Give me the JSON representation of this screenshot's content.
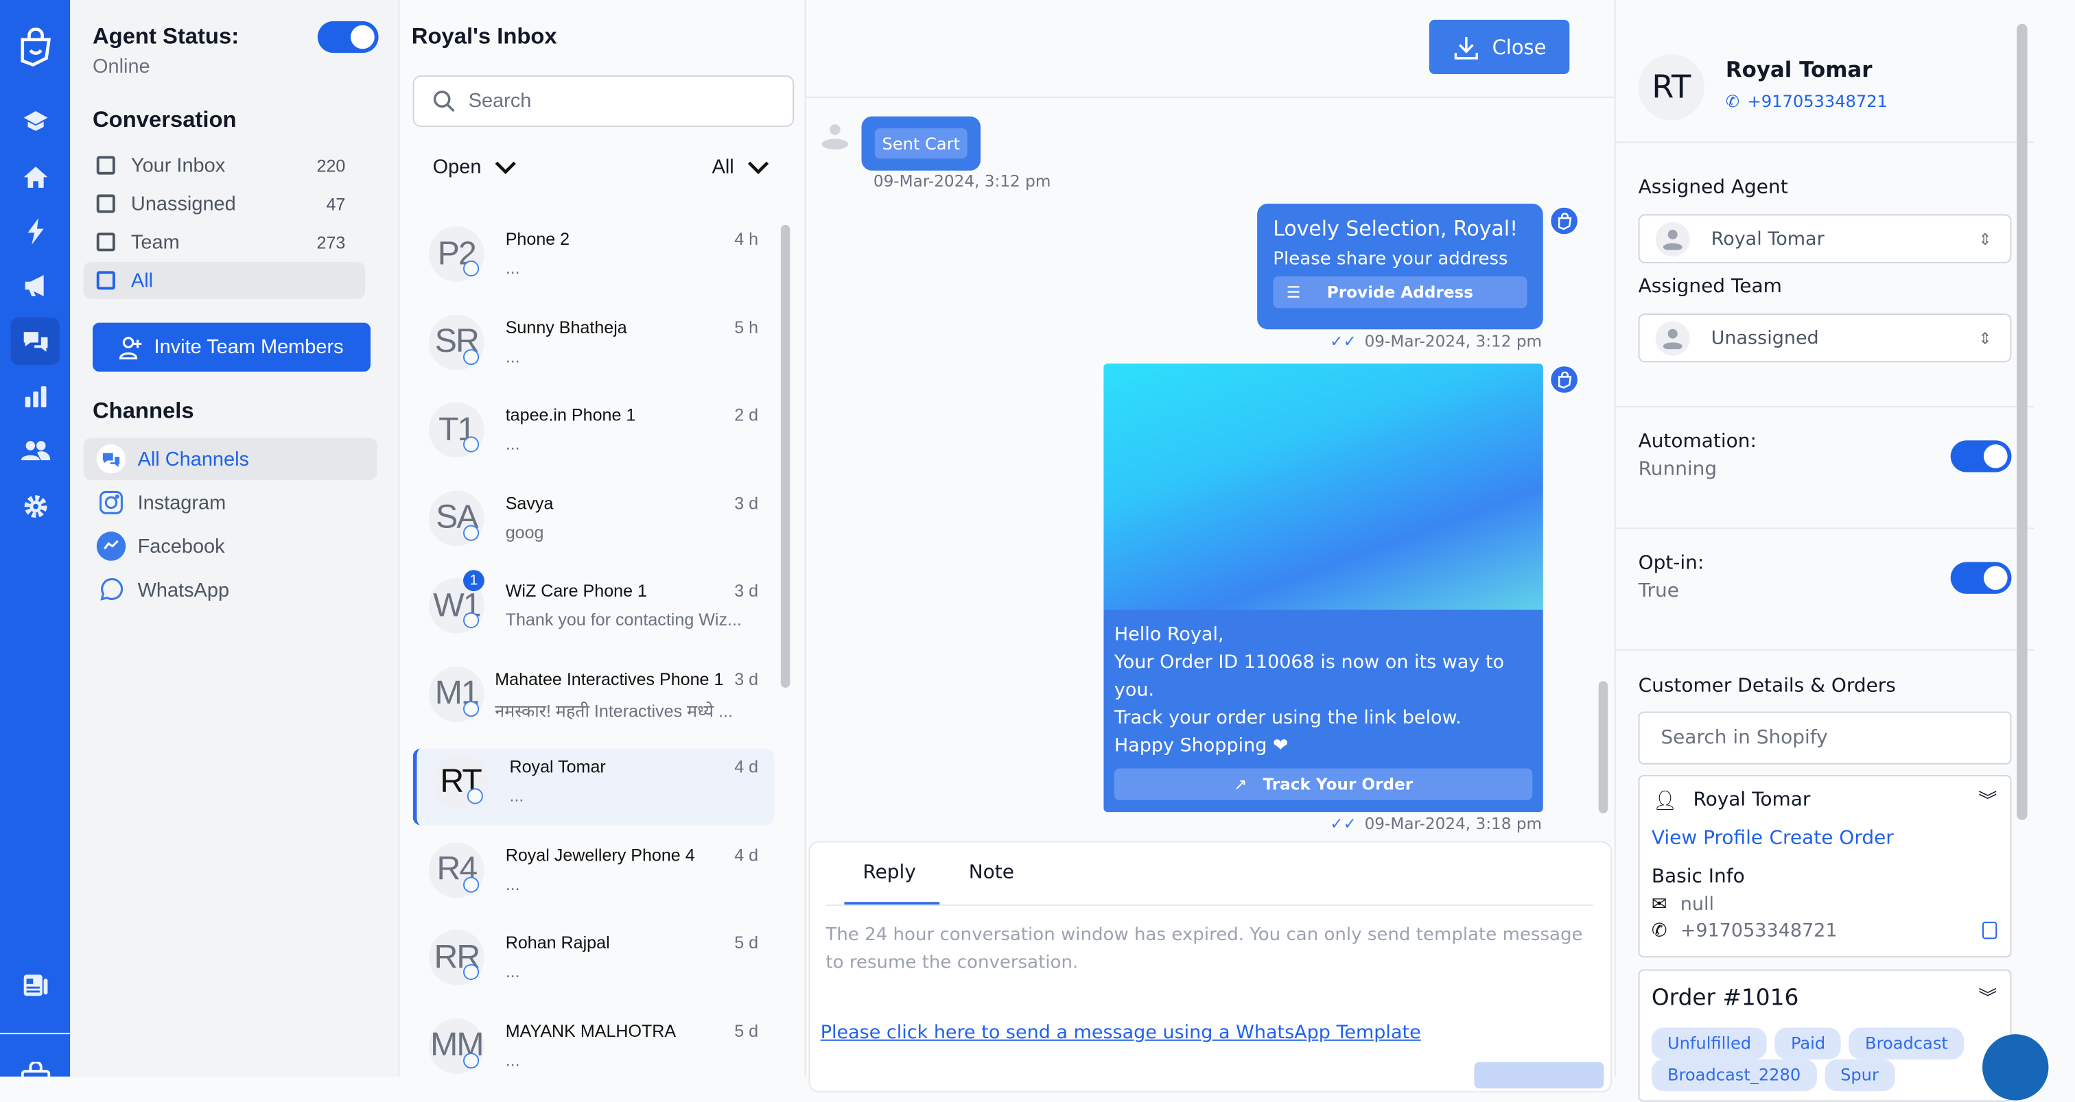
{
  "colors": {
    "brand": "#1f62ea",
    "bubble": "#3b7ae9",
    "link": "#1f62ea"
  },
  "nav": {
    "icons": [
      "logo-bag-icon",
      "learn-icon",
      "home-icon",
      "bolt-icon",
      "megaphone-icon",
      "chat-icon",
      "chart-icon",
      "users-icon",
      "gear-icon",
      "newspaper-icon",
      "bag-icon"
    ],
    "active": "chat-icon"
  },
  "sidebar": {
    "agent_status_label": "Agent Status:",
    "agent_status_value": "Online",
    "agent_online": true,
    "conversation_title": "Conversation",
    "conversation_items": [
      {
        "label": "Your Inbox",
        "count": "220"
      },
      {
        "label": "Unassigned",
        "count": "47"
      },
      {
        "label": "Team",
        "count": "273"
      },
      {
        "label": "All",
        "count": ""
      }
    ],
    "invite_label": "Invite Team Members",
    "channels_title": "Channels",
    "channels": [
      {
        "label": "All Channels"
      },
      {
        "label": "Instagram"
      },
      {
        "label": "Facebook"
      },
      {
        "label": "WhatsApp"
      }
    ]
  },
  "inbox": {
    "title": "Royal's Inbox",
    "search_placeholder": "Search",
    "status_filter": "Open",
    "type_filter": "All",
    "rows": [
      {
        "initials": "P2",
        "name": "Phone 2",
        "time": "4 h",
        "preview": "...",
        "unread": ""
      },
      {
        "initials": "SR",
        "name": "Sunny Bhatheja",
        "time": "5 h",
        "preview": "...",
        "unread": ""
      },
      {
        "initials": "T1",
        "name": "tapee.in Phone 1",
        "time": "2 d",
        "preview": "...",
        "unread": ""
      },
      {
        "initials": "SA",
        "name": "Savya",
        "time": "3 d",
        "preview": "goog",
        "unread": ""
      },
      {
        "initials": "W1",
        "name": "WiZ Care Phone 1",
        "time": "3 d",
        "preview": "Thank you for contacting Wiz...",
        "unread": "1"
      },
      {
        "initials": "M1",
        "name": "Mahatee Interactives Phone 1",
        "time": "3 d",
        "preview": "नमस्कार! महती Interactives मध्ये ...",
        "unread": ""
      },
      {
        "initials": "RT",
        "name": "Royal Tomar",
        "time": "4 d",
        "preview": "...",
        "unread": ""
      },
      {
        "initials": "R4",
        "name": "Royal Jewellery Phone 4",
        "time": "4 d",
        "preview": "...",
        "unread": ""
      },
      {
        "initials": "RR",
        "name": "Rohan Rajpal",
        "time": "5 d",
        "preview": "...",
        "unread": ""
      },
      {
        "initials": "MM",
        "name": "MAYANK MALHOTRA",
        "time": "5 d",
        "preview": "...",
        "unread": ""
      }
    ],
    "selected_index": 6
  },
  "chat": {
    "close_label": "Close",
    "messages": [
      {
        "type": "incoming",
        "button": "Sent Cart",
        "time": "09-Mar-2024, 3:12 pm"
      },
      {
        "type": "outgoing",
        "title": "Lovely Selection, Royal!",
        "body": "Please share your address",
        "button": "Provide Address",
        "time": "09-Mar-2024, 3:12 pm"
      },
      {
        "type": "outgoing",
        "lines": [
          "Hello Royal,",
          "Your Order ID 110068 is now on its way to you.",
          "Track your order using the link below.",
          "Happy Shopping ❤"
        ],
        "button": "Track Your Order",
        "time": "09-Mar-2024, 3:18 pm"
      }
    ],
    "reply_tabs": [
      "Reply",
      "Note"
    ],
    "active_tab": "Reply",
    "expired_notice": "The 24 hour conversation window has expired. You can only send template message to resume the conversation.",
    "template_link": "Please click here to send a message using a WhatsApp Template"
  },
  "contact": {
    "initials": "RT",
    "name": "Royal Tomar",
    "phone": "+917053348721",
    "assigned_agent_label": "Assigned Agent",
    "assigned_agent": "Royal Tomar",
    "assigned_team_label": "Assigned Team",
    "assigned_team": "Unassigned",
    "automation_label": "Automation:",
    "automation_value": "Running",
    "automation_on": true,
    "optin_label": "Opt-in:",
    "optin_value": "True",
    "optin_on": true,
    "customer_title": "Customer Details & Orders",
    "shopify_placeholder": "Search in Shopify",
    "customer_name": "Royal Tomar",
    "view_profile": "View Profile",
    "create_order": "Create Order",
    "basic_info": "Basic Info",
    "email": "null",
    "phone2": "+917053348721",
    "order_title": "Order #1016",
    "order_tags": [
      "Unfulfilled",
      "Paid",
      "Broadcast",
      "Broadcast_2280",
      "Spur"
    ]
  }
}
